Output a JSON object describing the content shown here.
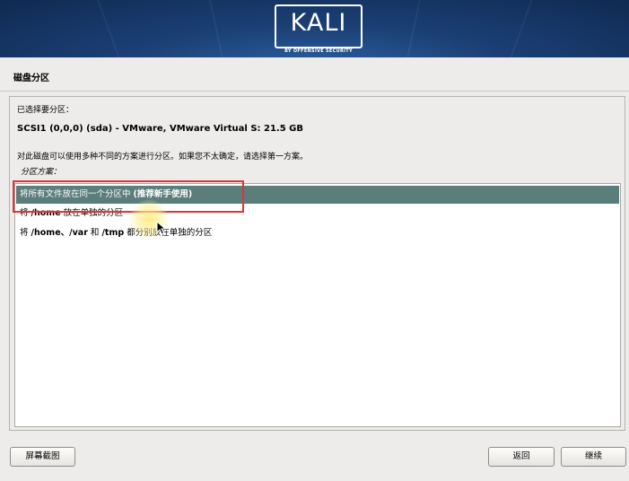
{
  "banner": {
    "logo": "KALI",
    "logo_sub": "BY OFFENSIVE SECURITY"
  },
  "page_title": "磁盘分区",
  "selected_label": "已选择要分区：",
  "disk": "SCSI1 (0,0,0) (sda) - VMware, VMware Virtual S: 21.5 GB",
  "description": "对此磁盘可以使用多种不同的方案进行分区。如果您不太确定，请选择第一方案。",
  "scheme_label": "分区方案：",
  "options": [
    {
      "pre": "将所有文件放在同一个分区中 ",
      "bold": "(推荐新手使用)",
      "post": "",
      "selected": true
    },
    {
      "pre": "将 ",
      "bold": "/home",
      "post": " 放在单独的分区",
      "selected": false
    },
    {
      "pre": "将 ",
      "bold": "/home、/var",
      "mid": " 和 ",
      "bold2": "/tmp",
      "post": " 都分别放在单独的分区",
      "selected": false
    }
  ],
  "buttons": {
    "screenshot": "屏幕截图",
    "back": "返回",
    "continue": "继续"
  },
  "colors": {
    "selection": "#5b7e7a",
    "highlight": "#e0343a",
    "banner": "#1b3f74"
  }
}
